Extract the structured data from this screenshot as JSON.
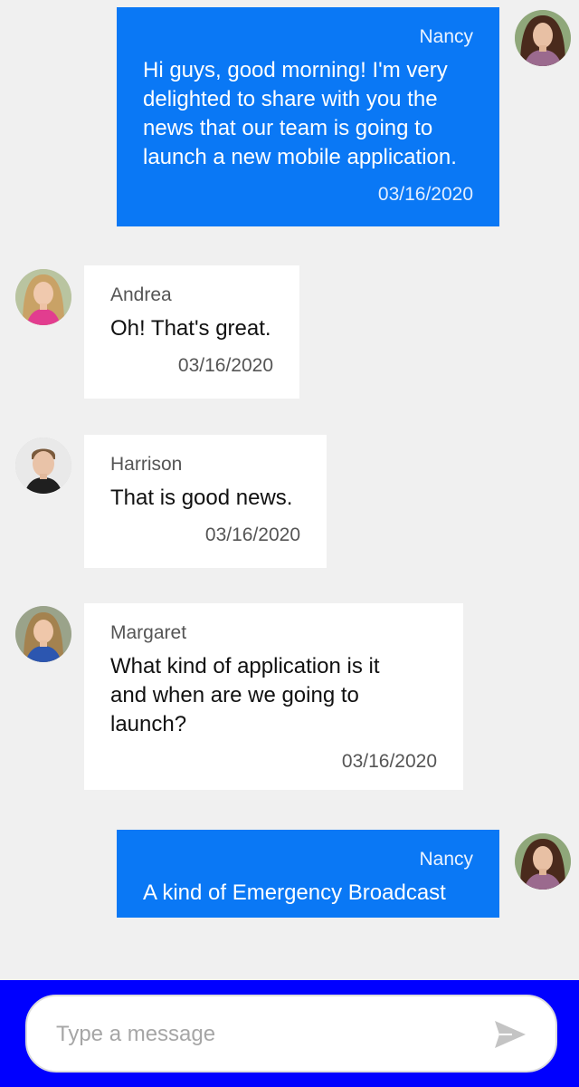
{
  "messages": [
    {
      "author": "Nancy",
      "text": "Hi guys, good morning! I'm very delighted to share with you the news that our team is going to launch a new mobile application.",
      "time": "03/16/2020",
      "direction": "outgoing"
    },
    {
      "author": "Andrea",
      "text": "Oh! That's great.",
      "time": "03/16/2020",
      "direction": "incoming"
    },
    {
      "author": "Harrison",
      "text": "That is good news.",
      "time": "03/16/2020",
      "direction": "incoming"
    },
    {
      "author": "Margaret",
      "text": "What kind of application is it and when are we going to launch?",
      "time": "03/16/2020",
      "direction": "incoming"
    },
    {
      "author": "Nancy",
      "text": "A kind of Emergency Broadcast",
      "time": "",
      "direction": "outgoing"
    }
  ],
  "composer": {
    "placeholder": "Type a message",
    "send_icon": "send-icon"
  },
  "colors": {
    "outgoing_bubble": "#0a78f5",
    "incoming_bubble": "#ffffff",
    "background": "#f0f0f0",
    "composer_bar": "#0000ff"
  }
}
